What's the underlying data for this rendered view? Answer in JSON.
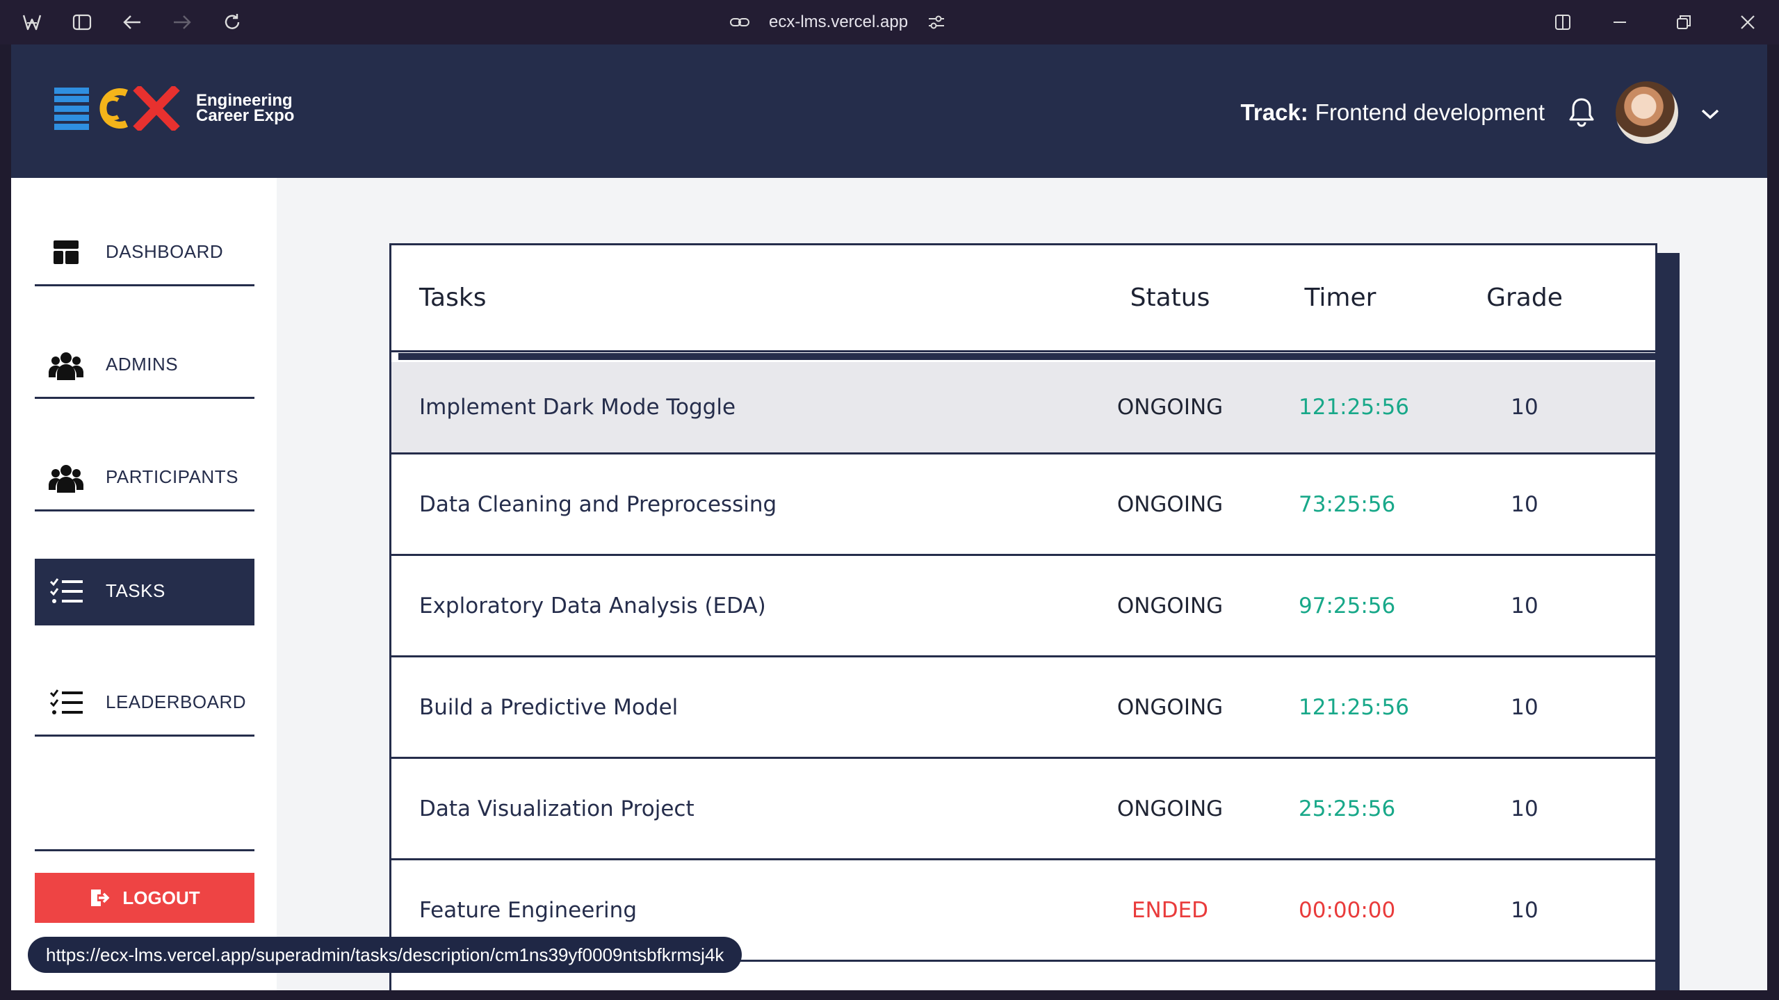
{
  "browser": {
    "url": "ecx-lms.vercel.app",
    "status_url": "https://ecx-lms.vercel.app/superadmin/tasks/description/cm1ns39yf0009ntsbfkrmsj4k"
  },
  "header": {
    "logo_text": "ECX",
    "logo_line1": "Engineering",
    "logo_line2": "Career Expo",
    "track_label": "Track:",
    "track_value": "Frontend development"
  },
  "sidebar": {
    "items": [
      {
        "label": "DASHBOARD",
        "icon": "dashboard-icon"
      },
      {
        "label": "ADMINS",
        "icon": "users-icon"
      },
      {
        "label": "PARTICIPANTS",
        "icon": "users-icon"
      },
      {
        "label": "TASKS",
        "icon": "checklist-icon",
        "active": true
      },
      {
        "label": "LEADERBOARD",
        "icon": "checklist-icon"
      }
    ],
    "logout_label": "LOGOUT"
  },
  "table": {
    "headers": {
      "task": "Tasks",
      "status": "Status",
      "timer": "Timer",
      "grade": "Grade"
    },
    "rows": [
      {
        "task": "Implement Dark Mode Toggle",
        "status": "ONGOING",
        "timer": "121:25:56",
        "grade": "10"
      },
      {
        "task": "Data Cleaning and Preprocessing",
        "status": "ONGOING",
        "timer": "73:25:56",
        "grade": "10"
      },
      {
        "task": "Exploratory Data Analysis (EDA)",
        "status": "ONGOING",
        "timer": "97:25:56",
        "grade": "10"
      },
      {
        "task": "Build a Predictive Model",
        "status": "ONGOING",
        "timer": "121:25:56",
        "grade": "10"
      },
      {
        "task": "Data Visualization Project",
        "status": "ONGOING",
        "timer": "25:25:56",
        "grade": "10"
      },
      {
        "task": "Feature Engineering",
        "status": "ENDED",
        "timer": "00:00:00",
        "grade": "10"
      }
    ]
  },
  "colors": {
    "navy": "#252d4b",
    "ongoing_timer": "#18a889",
    "ended": "#e93b3b",
    "logout": "#ee4444",
    "logo_blue": "#2f8fe0",
    "logo_yellow": "#f4b41a",
    "logo_red": "#e8312f"
  }
}
